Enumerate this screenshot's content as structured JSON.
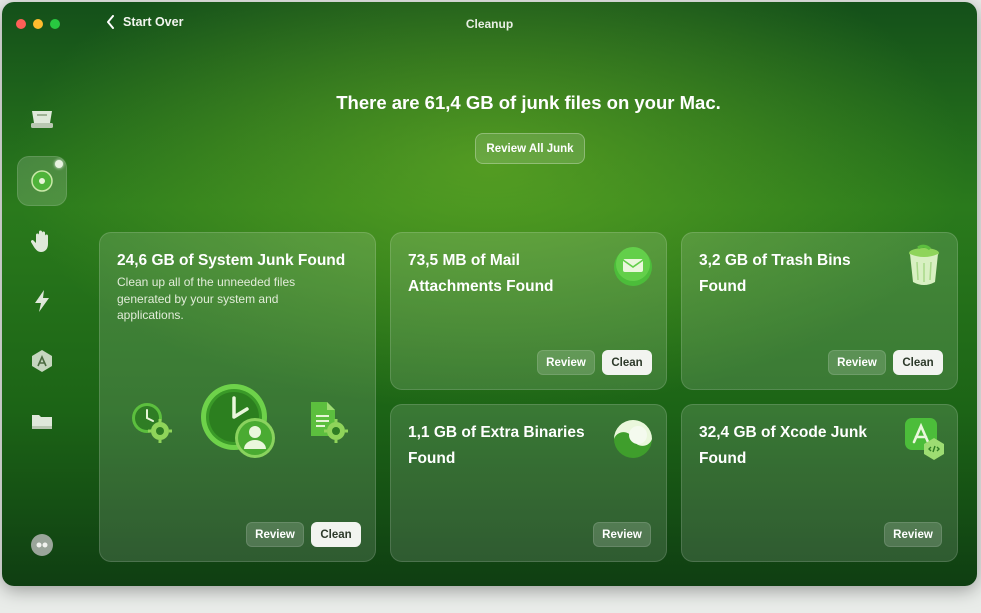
{
  "window": {
    "title": "Cleanup",
    "back_label": "Start Over"
  },
  "sidebar": {
    "items": [
      {
        "icon": "drive-icon"
      },
      {
        "icon": "cleanup-icon",
        "active": true
      },
      {
        "icon": "hand-icon"
      },
      {
        "icon": "lightning-icon"
      },
      {
        "icon": "app-store-icon"
      },
      {
        "icon": "folder-icon"
      },
      {
        "icon": "assistant-icon"
      }
    ]
  },
  "summary": {
    "headline": "There are 61,4 GB of junk files on your Mac.",
    "review_all_label": "Review All Junk"
  },
  "cards": {
    "system_junk": {
      "title": "24,6 GB of System Junk Found",
      "description": "Clean up all of the unneeded files generated by your system and applications.",
      "review_label": "Review",
      "clean_label": "Clean"
    },
    "mail": {
      "title": "73,5 MB of Mail Attachments Found",
      "review_label": "Review",
      "clean_label": "Clean"
    },
    "trash": {
      "title": "3,2 GB of Trash Bins Found",
      "review_label": "Review",
      "clean_label": "Clean"
    },
    "binaries": {
      "title": "1,1 GB of Extra Binaries Found",
      "review_label": "Review"
    },
    "xcode": {
      "title": "32,4 GB of Xcode Junk Found",
      "review_label": "Review"
    }
  },
  "colors": {
    "accent": "#3fa52a",
    "clean_button": "#f2f4f0"
  }
}
